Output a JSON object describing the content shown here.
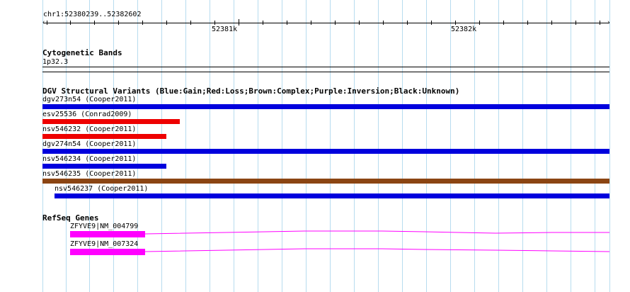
{
  "location": "chr1:52380239..52382602",
  "ruler": {
    "labels": [
      "52381k",
      "52382k"
    ]
  },
  "cytoband": {
    "title": "Cytogenetic Bands",
    "band": "1p32.3"
  },
  "dgv": {
    "title": "DGV Structural Variants (Blue:Gain;Red:Loss;Brown:Complex;Purple:Inversion;Black:Unknown)",
    "colors": {
      "gain": "#0000dd",
      "loss": "#ee0000",
      "complex": "#8b4513"
    },
    "items": [
      {
        "label": "dgv273n54 (Cooper2011)",
        "type": "gain"
      },
      {
        "label": "esv25536 (Conrad2009)",
        "type": "loss"
      },
      {
        "label": "nsv546232 (Cooper2011)",
        "type": "loss"
      },
      {
        "label": "dgv274n54 (Cooper2011)",
        "type": "gain"
      },
      {
        "label": "nsv546234 (Cooper2011)",
        "type": "gain"
      },
      {
        "label": "nsv546235 (Cooper2011)",
        "type": "complex"
      },
      {
        "label": "nsv546237 (Cooper2011)",
        "type": "gain"
      }
    ]
  },
  "refseq": {
    "title": "RefSeq Genes",
    "color": "#ff00ff",
    "genes": [
      {
        "label": "ZFYVE9|NM_004799"
      },
      {
        "label": "ZFYVE9|NM_007324"
      }
    ]
  }
}
